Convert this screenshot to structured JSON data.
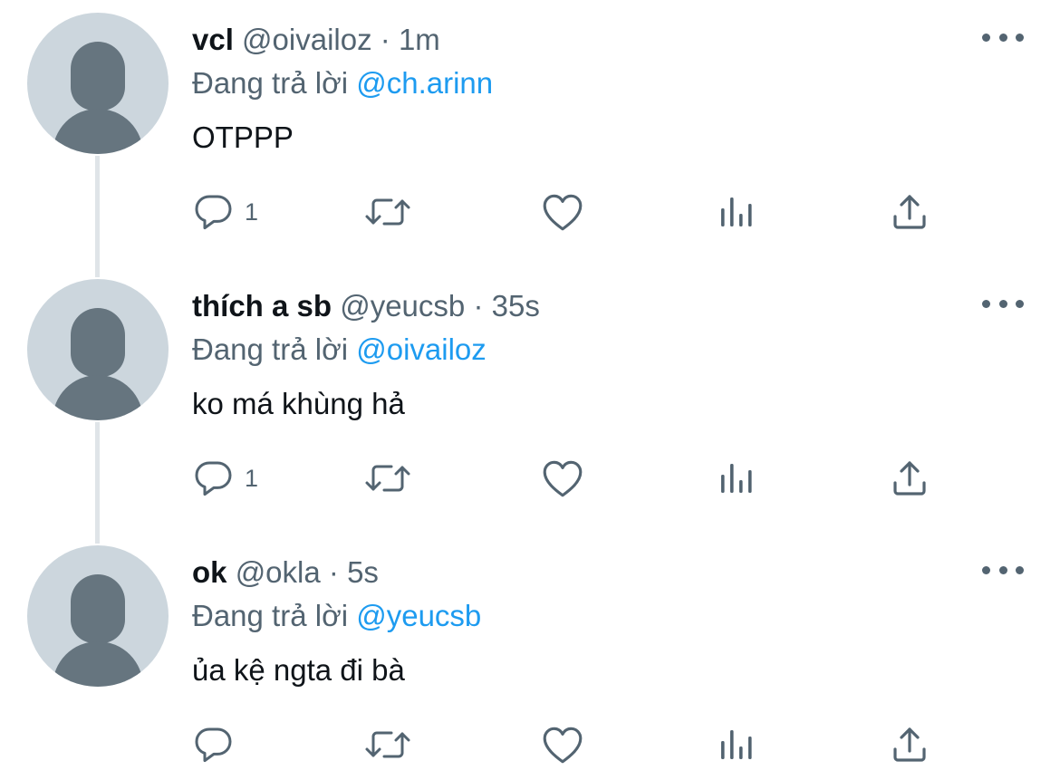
{
  "colors": {
    "text_primary": "#0f1419",
    "text_secondary": "#536471",
    "mention": "#1d9bf0",
    "avatar_bg": "#ccd6dd",
    "avatar_silhouette": "#66757f",
    "thread_line": "#dfe4e8"
  },
  "icons": [
    "reply-icon",
    "retweet-icon",
    "like-icon",
    "views-icon",
    "share-icon",
    "more-icon"
  ],
  "tweets": [
    {
      "name": "vcl",
      "handle": "@oivailoz",
      "separator": "·",
      "time": "1m",
      "replying_prefix": "Đang trả lời",
      "replying_to": "@ch.arinn",
      "text": "OTPPP",
      "reply_count": "1"
    },
    {
      "name": "thích a sb",
      "handle": "@yeucsb",
      "separator": "·",
      "time": "35s",
      "replying_prefix": "Đang trả lời",
      "replying_to": "@oivailoz",
      "text": "ko má khùng hả",
      "reply_count": "1"
    },
    {
      "name": "ok",
      "handle": "@okla",
      "separator": "·",
      "time": "5s",
      "replying_prefix": "Đang trả lời",
      "replying_to": "@yeucsb",
      "text": "ủa kệ ngta đi bà",
      "reply_count": ""
    }
  ]
}
